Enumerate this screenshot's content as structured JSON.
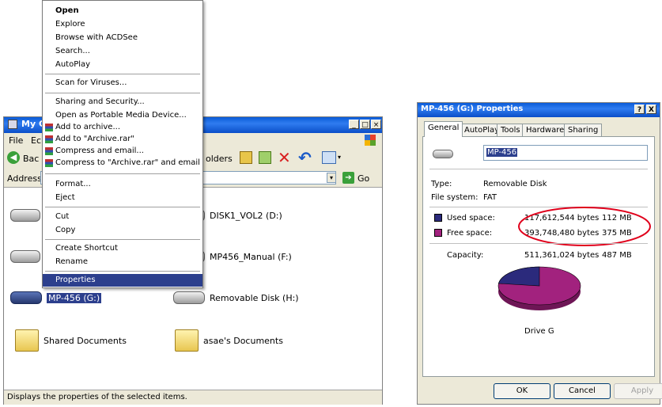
{
  "explorer": {
    "title": "My Co",
    "menu": [
      "File",
      "Ec"
    ],
    "toolbar": {
      "back": "Bac",
      "folders": "olders"
    },
    "address_label": "Address",
    "go_label": "Go",
    "drives": [
      {
        "label": "DISK1_VOL2 (D:)"
      },
      {
        "label": "MP456_Manual (F:)"
      },
      {
        "label": "MP-456 (G:)"
      },
      {
        "label": "Removable Disk (H:)"
      }
    ],
    "folders": [
      {
        "label": "Shared Documents"
      },
      {
        "label": "asae's Documents"
      }
    ],
    "status": "Displays the properties of the selected items."
  },
  "context_menu": {
    "items": [
      "Open",
      "Explore",
      "Browse with ACDSee",
      "Search...",
      "AutoPlay",
      "Scan for Viruses...",
      "Sharing and Security...",
      "Open as Portable Media Device...",
      "Add to archive...",
      "Add to \"Archive.rar\"",
      "Compress and email...",
      "Compress to \"Archive.rar\" and email",
      "Format...",
      "Eject",
      "Cut",
      "Copy",
      "Create Shortcut",
      "Rename",
      "Properties"
    ]
  },
  "properties": {
    "title": "MP-456 (G:) Properties",
    "title_buttons": [
      "?",
      "X"
    ],
    "tabs": [
      "General",
      "AutoPlay",
      "Tools",
      "Hardware",
      "Sharing"
    ],
    "name": "MP-456",
    "type_label": "Type:",
    "type_value": "Removable Disk",
    "fs_label": "File system:",
    "fs_value": "FAT",
    "used_label": "Used space:",
    "used_bytes": "117,612,544 bytes",
    "used_mb": "112 MB",
    "free_label": "Free space:",
    "free_bytes": "393,748,480 bytes",
    "free_mb": "375 MB",
    "capacity_label": "Capacity:",
    "capacity_bytes": "511,361,024 bytes",
    "capacity_mb": "487 MB",
    "drive_label": "Drive G",
    "used_fraction": 0.23,
    "colors": {
      "used": "#2b2a7c",
      "free": "#a2227e",
      "highlight": "#e0001b"
    },
    "buttons": {
      "ok": "OK",
      "cancel": "Cancel",
      "apply": "Apply"
    }
  }
}
